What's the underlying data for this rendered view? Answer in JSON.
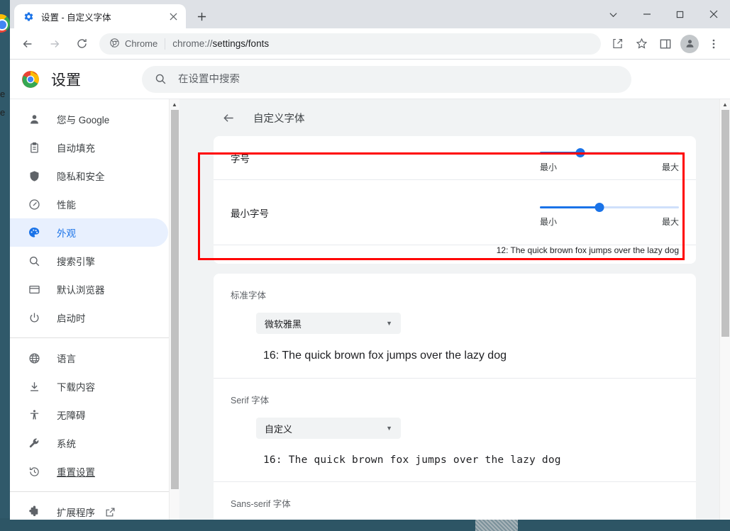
{
  "window": {
    "tab": {
      "title": "设置 - 自定义字体",
      "favicon": "settings-gear-icon",
      "close": "×"
    },
    "new_tab_label": "+",
    "controls": {
      "tab_search": "tab-search-chevron",
      "minimize": "minimize",
      "maximize": "maximize",
      "close": "close"
    }
  },
  "toolbar": {
    "back": "back-arrow",
    "forward": "forward-arrow",
    "reload": "reload",
    "omnibox": {
      "chip_label": "Chrome",
      "url_scheme": "chrome://",
      "url_path": "settings/fonts",
      "full_url": "chrome://settings/fonts"
    },
    "share": "share-icon",
    "bookmark": "star-icon",
    "side_panel": "side-panel-icon",
    "profile": "avatar",
    "menu": "three-dot-menu"
  },
  "settings_header": {
    "title": "设置",
    "search_placeholder": "在设置中搜索",
    "search_value": ""
  },
  "sidebar": {
    "items": [
      {
        "label": "您与 Google",
        "icon": "person-icon",
        "selected": false
      },
      {
        "label": "自动填充",
        "icon": "clipboard-icon",
        "selected": false
      },
      {
        "label": "隐私和安全",
        "icon": "shield-icon",
        "selected": false
      },
      {
        "label": "性能",
        "icon": "speedometer-icon",
        "selected": false
      },
      {
        "label": "外观",
        "icon": "palette-icon",
        "selected": true
      },
      {
        "label": "搜索引擎",
        "icon": "search-icon",
        "selected": false
      },
      {
        "label": "默认浏览器",
        "icon": "browser-window-icon",
        "selected": false
      },
      {
        "label": "启动时",
        "icon": "power-icon",
        "selected": false
      }
    ],
    "items_group2": [
      {
        "label": "语言",
        "icon": "globe-icon"
      },
      {
        "label": "下载内容",
        "icon": "download-icon"
      },
      {
        "label": "无障碍",
        "icon": "accessibility-icon"
      },
      {
        "label": "系统",
        "icon": "wrench-icon"
      },
      {
        "label": "重置设置",
        "icon": "history-restore-icon",
        "underline": true
      }
    ],
    "items_group3": [
      {
        "label": "扩展程序",
        "icon": "puzzle-icon",
        "external": true
      }
    ]
  },
  "page": {
    "back": "back-arrow",
    "title": "自定义字体",
    "font_size_row": {
      "label": "字号",
      "slider": {
        "min_label": "最小",
        "max_label": "最大",
        "percent": 29
      }
    },
    "min_font_size_row": {
      "label": "最小字号",
      "slider": {
        "min_label": "最小",
        "max_label": "最大",
        "percent": 43
      },
      "preview": "12: The quick brown fox jumps over the lazy dog"
    },
    "sections": [
      {
        "title": "标准字体",
        "dropdown_value": "微软雅黑",
        "sample": "16: The quick brown fox jumps over the lazy dog",
        "sample_style": "sans"
      },
      {
        "title": "Serif 字体",
        "dropdown_value": "自定义",
        "sample": "16: The quick brown fox jumps over the lazy dog",
        "sample_style": "mono"
      },
      {
        "title": "Sans-serif 字体",
        "dropdown_value": "",
        "sample": "",
        "sample_style": "sans"
      }
    ]
  },
  "colors": {
    "accent": "#1a73e8",
    "selected_pill": "#e8f0fe",
    "highlight_box": "#ff0000",
    "titlebar": "#dee1e6",
    "page_bg": "#f1f3f4"
  },
  "background": {
    "partial_text_1": "e",
    "partial_text_2": "e"
  }
}
